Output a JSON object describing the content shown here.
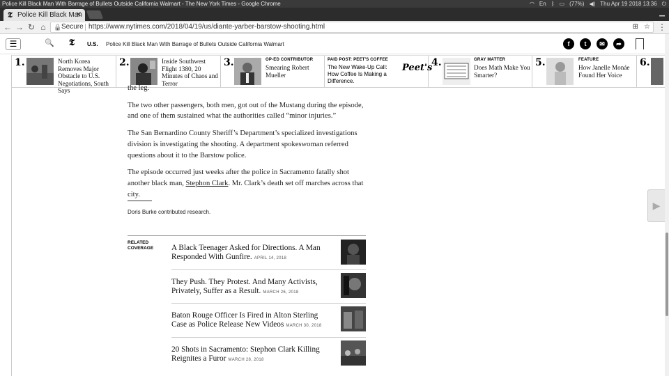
{
  "system": {
    "window_title": "Police Kill Black Man With Barrage of Bullets Outside California Walmart - The New York Times - Google Chrome",
    "battery": "(77%)",
    "clock": "Thu Apr 19 2018 13:36"
  },
  "browser": {
    "tab_title": "Police Kill Black Man",
    "secure_label": "Secure",
    "url": "https://www.nytimes.com/2018/04/19/us/diante-yarber-barstow-shooting.html"
  },
  "header": {
    "section": "U.S.",
    "headline": "Police Kill Black Man With Barrage of Bullets Outside California Walmart"
  },
  "ribbon": [
    {
      "num": "1.",
      "text": "North Korea Removes Major Obstacle to U.S. Negotiations, South Says"
    },
    {
      "num": "2.",
      "text": "Inside Southwest Flight 1380, 20 Minutes of Chaos and Terror"
    },
    {
      "num": "3.",
      "kicker": "OP-ED CONTRIBUTOR",
      "text": "Smearing Robert Mueller"
    },
    {
      "kicker": "PAID POST: PEET'S COFFEE",
      "text": "The New Wake-Up Call: How Coffee Is Making a Difference.",
      "brand": "Peet's"
    },
    {
      "num": "4.",
      "kicker": "GRAY MATTER",
      "text": "Does Math Make You Smarter?"
    },
    {
      "num": "5.",
      "kicker": "FEATURE",
      "text": "How Janelle Monáe Found Her Voice"
    },
    {
      "num": "6."
    }
  ],
  "article": {
    "frag": "the leg.",
    "p1": "The two other passengers, both men, got out of the Mustang during the episode, and one of them sustained what the authorities called “minor injuries.”",
    "p2": "The San Bernardino County Sheriff’s Department’s specialized investigations division is investigating the shooting. A department spokeswoman referred questions about it to the Barstow police.",
    "p3a": "The episode occurred just weeks after the police in Sacramento fatally shot another black man, ",
    "p3link": "Stephon Clark",
    "p3b": ". Mr. Clark’s death set off marches across that city.",
    "contrib": "Doris Burke contributed research."
  },
  "related": {
    "kicker": "RELATED COVERAGE",
    "items": [
      {
        "title": "A Black Teenager Asked for Directions. A Man Responded With Gunfire.",
        "date": "APRIL 14, 2018"
      },
      {
        "title": "They Push. They Protest. And Many Activists, Privately, Suffer as a Result.",
        "date": "MARCH 26, 2018"
      },
      {
        "title": "Baton Rouge Officer Is Fired in Alton Sterling Case as Police Release New Videos",
        "date": "MARCH 30, 2018"
      },
      {
        "title": "20 Shots in Sacramento: Stephon Clark Killing Reignites a Furor",
        "date": "MARCH 28, 2018"
      }
    ]
  }
}
